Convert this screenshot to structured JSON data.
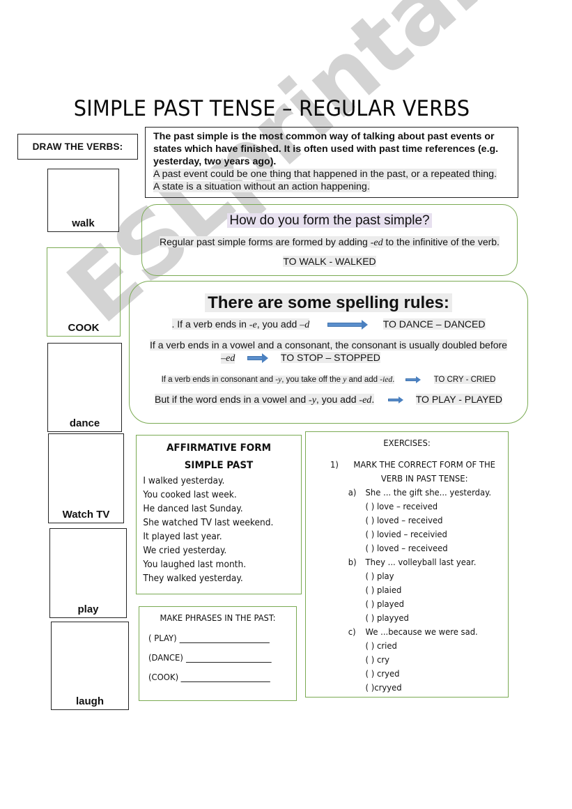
{
  "page_title": "SIMPLE PAST TENSE – REGULAR VERBS",
  "draw_section": {
    "label": "DRAW THE VERBS:",
    "verbs": [
      "walk",
      "COOK",
      "dance",
      "Watch TV",
      "play",
      "laugh"
    ]
  },
  "intro": {
    "bold_text": "The past simple is the most common way of talking about past events or states which have finished. It is often used with past time references (e.g. yesterday, two years ago).",
    "line1": "A past event could be one thing that happened in the past, or a repeated thing.",
    "line2": "A state is a situation without an action happening."
  },
  "form": {
    "question": "How do you form the past simple?",
    "desc_before": "Regular past simple forms are formed by adding ",
    "desc_suffix": "-ed",
    "desc_after": " to the infinitive of the verb.",
    "example": "TO WALK - WALKED"
  },
  "spelling": {
    "heading": "There are some spelling rules:",
    "rules": [
      {
        "a": ". If a verb ends in ",
        "i1": "-e",
        "b": ", you add ",
        "i2": "–d",
        "c": "",
        "example": "TO DANCE – DANCED"
      },
      {
        "a": "If a verb ends in a vowel and a consonant, the consonant is usually doubled before",
        "i1": "–ed",
        "example": "TO STOP – STOPPED"
      },
      {
        "a": "If a verb ends in consonant and ",
        "i1": "-y",
        "b": ", you take off the ",
        "i2": "y",
        "c": " and add ",
        "i3": "-ied",
        "d": ".",
        "example": "TO CRY - CRIED"
      },
      {
        "a": "But if the word ends in a vowel and ",
        "i1": "-y",
        "b": ", you add ",
        "i2": "-ed",
        "c": ".",
        "example": "TO PLAY - PLAYED"
      }
    ],
    "arrow_icon": "right-arrow"
  },
  "affirmative": {
    "heading_line1": "AFFIRMATIVE FORM",
    "heading_line2": "SIMPLE PAST",
    "sentences": [
      "I walked yesterday.",
      "You cooked last week.",
      "He danced last Sunday.",
      "She watched TV last weekend.",
      "It played last year.",
      "We cried yesterday.",
      "You laughed last month.",
      "They walked yesterday."
    ]
  },
  "phrases": {
    "heading": "MAKE PHRASES IN THE PAST:",
    "prompts": [
      "( PLAY)",
      "(DANCE)",
      "(COOK)"
    ],
    "answers": [
      "",
      "",
      ""
    ]
  },
  "exercises": {
    "heading": "EXERCISES:",
    "q1_number": "1)",
    "q1_text": "MARK THE CORRECT FORM OF THE VERB IN PAST TENSE:",
    "items": [
      {
        "label": "a)",
        "prompt": "She ... the gift she... yesterday.",
        "options": [
          "( ) love – received",
          "( ) loved – received",
          "( ) lovied – receivied",
          "( ) loved – receiveed"
        ]
      },
      {
        "label": "b)",
        "prompt": "They ... volleyball last year.",
        "options": [
          "( ) play",
          "( ) plaied",
          "( ) played",
          "( ) playyed"
        ]
      },
      {
        "label": "c)",
        "prompt": "We ...because we were sad.",
        "options": [
          "( ) cried",
          "( ) cry",
          "( ) cryed",
          "( )cryyed"
        ]
      }
    ]
  },
  "watermark": "ESLprintables.com",
  "colors": {
    "green_border": "#7aaa52",
    "arrow_blue": "#5b8fcc",
    "question_highlight": "#e7e0ef"
  }
}
